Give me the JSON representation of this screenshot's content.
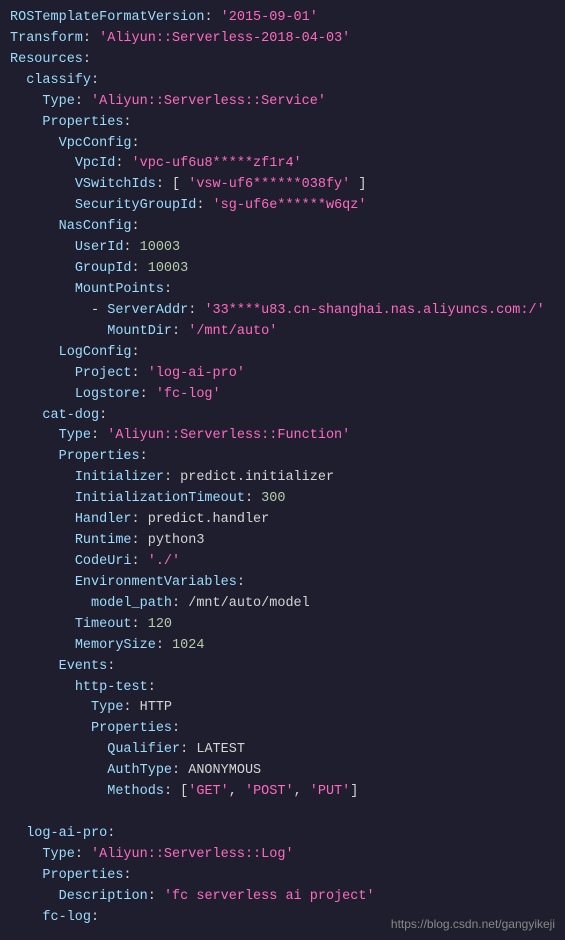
{
  "version_key": "ROSTemplateFormatVersion",
  "version_val": "'2015-09-01'",
  "transform_key": "Transform",
  "transform_val": "'Aliyun::Serverless-2018-04-03'",
  "resources_key": "Resources",
  "classify_key": "classify",
  "type_key": "Type",
  "service_type": "'Aliyun::Serverless::Service'",
  "properties_key": "Properties",
  "vpcconfig_key": "VpcConfig",
  "vpcid_key": "VpcId",
  "vpcid_val": "'vpc-uf6u8*****zf1r4'",
  "vswitch_key": "VSwitchIds",
  "vswitch_val": "'vsw-uf6******038fy'",
  "sg_key": "SecurityGroupId",
  "sg_val": "'sg-uf6e******w6qz'",
  "nasconfig_key": "NasConfig",
  "userid_key": "UserId",
  "userid_val": "10003",
  "groupid_key": "GroupId",
  "groupid_val": "10003",
  "mountpoints_key": "MountPoints",
  "serveraddr_key": "ServerAddr",
  "serveraddr_val": "'33****u83.cn-shanghai.nas.aliyuncs.com:/'",
  "mountdir_key": "MountDir",
  "mountdir_val": "'/mnt/auto'",
  "logconfig_key": "LogConfig",
  "project_key": "Project",
  "project_val": "'log-ai-pro'",
  "logstore_key": "Logstore",
  "logstore_val": "'fc-log'",
  "catdog_key": "cat-dog",
  "function_type": "'Aliyun::Serverless::Function'",
  "initializer_key": "Initializer",
  "initializer_val": "predict.initializer",
  "inittimeout_key": "InitializationTimeout",
  "inittimeout_val": "300",
  "handler_key": "Handler",
  "handler_val": "predict.handler",
  "runtime_key": "Runtime",
  "runtime_val": "python3",
  "codeuri_key": "CodeUri",
  "codeuri_val": "'./'",
  "envvars_key": "EnvironmentVariables",
  "modelpath_key": "model_path",
  "modelpath_val": "/mnt/auto/model",
  "timeout_key": "Timeout",
  "timeout_val": "120",
  "memory_key": "MemorySize",
  "memory_val": "1024",
  "events_key": "Events",
  "httptest_key": "http-test",
  "http_type": "HTTP",
  "qualifier_key": "Qualifier",
  "qualifier_val": "LATEST",
  "authtype_key": "AuthType",
  "authtype_val": "ANONYMOUS",
  "methods_key": "Methods",
  "method_get": "'GET'",
  "method_post": "'POST'",
  "method_put": "'PUT'",
  "logaipro_key": "log-ai-pro",
  "log_type": "'Aliyun::Serverless::Log'",
  "description_key": "Description",
  "description_val": "'fc serverless ai project'",
  "fclog_key": "fc-log",
  "watermark": "https://blog.csdn.net/gangyikeji"
}
